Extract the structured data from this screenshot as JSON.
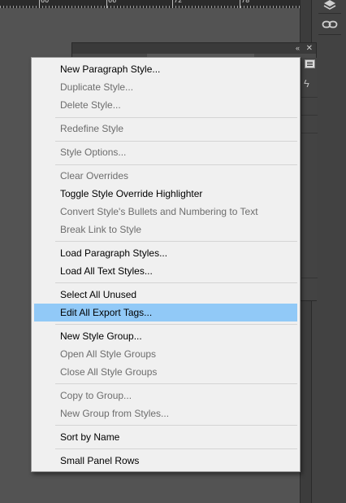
{
  "ruler": {
    "ticks": [
      "60",
      "66",
      "72",
      "78"
    ]
  },
  "dock": {
    "icons": [
      "layers-icon",
      "link-icon"
    ]
  },
  "panel": {
    "menu_icon": "panel-menu-icon",
    "collapse_glyph": "«",
    "close_glyph": "✕"
  },
  "menu": {
    "new_paragraph_style": "New Paragraph Style...",
    "duplicate_style": "Duplicate Style...",
    "delete_style": "Delete Style...",
    "redefine_style": "Redefine Style",
    "style_options": "Style Options...",
    "clear_overrides": "Clear Overrides",
    "toggle_highlighter": "Toggle Style Override Highlighter",
    "convert_bullets": "Convert Style's Bullets and Numbering to Text",
    "break_link": "Break Link to Style",
    "load_paragraph_styles": "Load Paragraph Styles...",
    "load_all_text_styles": "Load All Text Styles...",
    "select_all_unused": "Select All Unused",
    "edit_export_tags": "Edit All Export Tags...",
    "new_style_group": "New Style Group...",
    "open_all_groups": "Open All Style Groups",
    "close_all_groups": "Close All Style Groups",
    "copy_to_group": "Copy to Group...",
    "new_group_from_styles": "New Group from Styles...",
    "sort_by_name": "Sort by Name",
    "small_panel_rows": "Small Panel Rows"
  },
  "colors": {
    "highlight": "#91c9f7",
    "menu_bg": "#f0f0f0",
    "disabled_text": "#6d6d6d",
    "workspace": "#535353"
  }
}
